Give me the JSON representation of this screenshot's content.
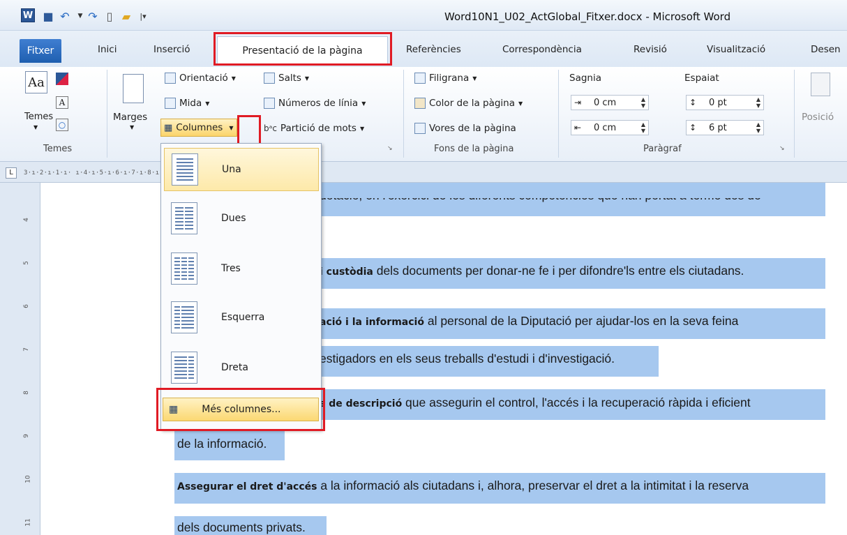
{
  "window": {
    "title": "Word10N1_U02_ActGlobal_Fitxer.docx - Microsoft Word",
    "app_icon": "W"
  },
  "tabs": [
    "Fitxer",
    "Inici",
    "Inserció",
    "Presentació de la pàgina",
    "Referències",
    "Correspondència",
    "Revisió",
    "Visualització",
    "Desen"
  ],
  "ribbon": {
    "temes": {
      "button": "Temes",
      "group": "Temes"
    },
    "marges": "Marges",
    "orientacio": "Orientació",
    "mida": "Mida",
    "columnes": "Columnes",
    "salts": "Salts",
    "numeros_linia": "Números de línia",
    "particio": "Partició de mots",
    "fons": {
      "filigrana": "Filigrana",
      "color": "Color de la pàgina",
      "vores": "Vores de la pàgina",
      "group": "Fons de la pàgina"
    },
    "paragraf": {
      "sagnia": "Sagnia",
      "espaiat": "Espaiat",
      "sagnia_left": "0 cm",
      "sagnia_right": "0 cm",
      "abans": "0 pt",
      "despres": "6 pt",
      "group": "Paràgraf"
    },
    "posicio": "Posició"
  },
  "ruler": {
    "ticks": "3·ı·2·ı·1·ı·                                                ı·4·ı·5·ı·6·ı·7·ı·8·ı·9·ı·10·ı·11·ı·12·ı·13·ı·14·ı·△·ı"
  },
  "vruler": [
    "4",
    "5",
    "6",
    "7",
    "8",
    "9",
    "10",
    "11"
  ],
  "menu": {
    "items": [
      "Una",
      "Dues",
      "Tres",
      "Esquerra",
      "Dreta"
    ],
    "more": "Més columnes..."
  },
  "doc": {
    "line1": "dotació, en l'exercici de les diferents competències que han portat a terme des de",
    "l2b": "i custòdia",
    "l2": " dels documents per donar-ne fe i per difondre'ls entre els ciutadans.",
    "l3b": "ació i la informació",
    "l3": " al personal de la Diputació per ajudar-los en la seva feina",
    "l4": "estigadors en els seus treballs d'estudi i d'investigació.",
    "l5b": "s de descripció",
    "l5": " que assegurin el control, l'accés i la recuperació ràpida i eficient",
    "l6": "de la informació.",
    "l7b": "Assegurar el dret d'accés",
    "l7": " a la informació als ciutadans i, alhora, preservar el dret a la intimitat i la reserva",
    "l8": "dels documents privats."
  },
  "colors": {
    "highlight": "#a6c8ef",
    "file_tab": "#2b6cc4",
    "annotation": "#e01b24",
    "menu_hover": "#fde9a9"
  }
}
